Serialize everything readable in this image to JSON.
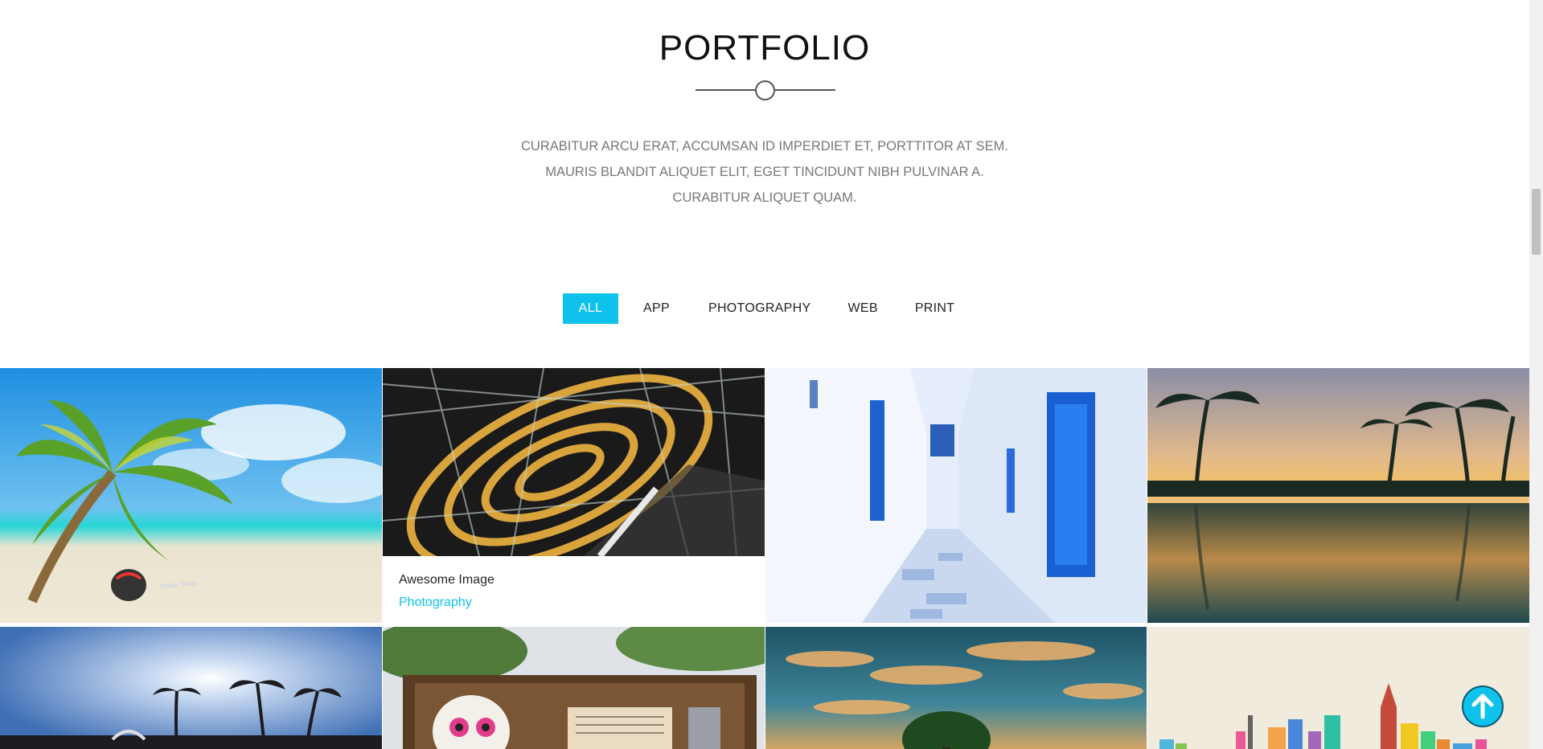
{
  "section": {
    "title": "PORTFOLIO",
    "description": "CURABITUR ARCU ERAT, ACCUMSAN ID IMPERDIET ET, PORTTITOR AT SEM. MAURIS BLANDIT ALIQUET ELIT, EGET TINCIDUNT NIBH PULVINAR A. CURABITUR ALIQUET QUAM."
  },
  "filters": {
    "active": "ALL",
    "items": [
      {
        "label": "ALL"
      },
      {
        "label": "APP"
      },
      {
        "label": "PHOTOGRAPHY"
      },
      {
        "label": "WEB"
      },
      {
        "label": "PRINT"
      }
    ]
  },
  "portfolio": {
    "hover_item": {
      "title": "Awesome Image",
      "category": "Photography"
    },
    "items": [
      {
        "subject": "palm-tree-beach"
      },
      {
        "subject": "spiral-building-interior"
      },
      {
        "subject": "whitewashed-alley-blue-doors"
      },
      {
        "subject": "resort-pool-sunset"
      },
      {
        "subject": "palm-trees-sunny-sky"
      },
      {
        "subject": "skull-crate-sheet-music"
      },
      {
        "subject": "tree-sunset-clouds"
      },
      {
        "subject": "colorful-city-skyline"
      }
    ]
  },
  "colors": {
    "accent": "#0fc2eb",
    "text": "#222222",
    "muted": "#777777"
  },
  "icons": {
    "back_to_top": "arrow-up-circle-icon"
  }
}
